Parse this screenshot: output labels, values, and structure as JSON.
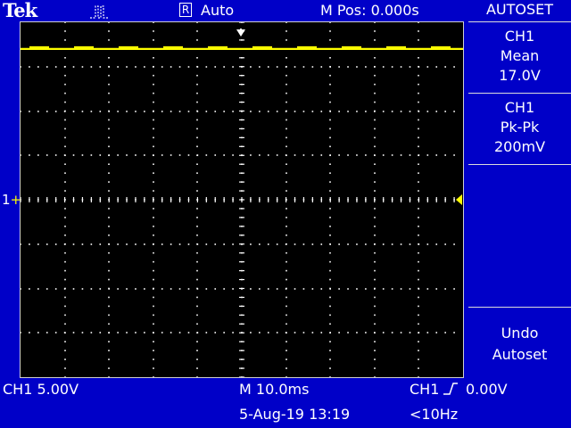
{
  "header": {
    "brand": "Tek",
    "acquisition_mode_icon": "pulse-waveform-icon",
    "trigger_state_icon": "R",
    "trigger_state": "Auto",
    "horizontal_position": "M Pos: 0.000s"
  },
  "menu": {
    "title": "AUTOSET",
    "measure1": {
      "channel": "CH1",
      "type": "Mean",
      "value": "17.0V"
    },
    "measure2": {
      "channel": "CH1",
      "type": "Pk-Pk",
      "value": "200mV"
    },
    "undo": {
      "line1": "Undo",
      "line2": "Autoset"
    }
  },
  "status": {
    "ch1_scale": "CH1  5.00V",
    "timebase": "M 10.0ms",
    "date_time": "5-Aug-19 13:19",
    "trigger_source": "CH1",
    "trigger_slope_icon": "rising-edge-icon",
    "trigger_level": "0.00V",
    "frequency": "<10Hz"
  },
  "markers": {
    "channel_label": "1"
  },
  "colors": {
    "background": "#0000c8",
    "screen": "#000000",
    "trace": "#ffff00",
    "graticule": "#ffffff"
  },
  "chart_data": {
    "type": "line",
    "grid": "10x8 dotted graticule",
    "series": [
      {
        "name": "CH1",
        "values": [
          17.0,
          17.0
        ]
      }
    ],
    "ylim": [
      -20,
      20
    ]
  }
}
